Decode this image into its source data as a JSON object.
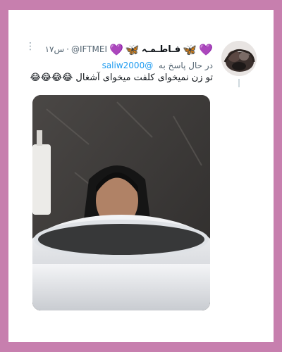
{
  "tweet": {
    "display_name": "فـاطـمـہ",
    "name_emoji_left": "🦋",
    "name_emoji_right": "🦋",
    "heart_left": "💜",
    "heart_right": "💜",
    "handle": "@IFTMEI",
    "separator": "·",
    "timestamp": "۱۷س",
    "reply_prefix": "در حال پاسخ به",
    "reply_to": "@saliw2000",
    "text": "تو زن نمیخوای کلفت میخوای آشغال 😂😂😂😂",
    "more_label": "⋮"
  },
  "icons": {
    "more": "more-vertical-icon",
    "avatar": "avatar"
  },
  "colors": {
    "frame": "#c77fae",
    "link": "#1d9bf0",
    "secondary_text": "#536471"
  }
}
